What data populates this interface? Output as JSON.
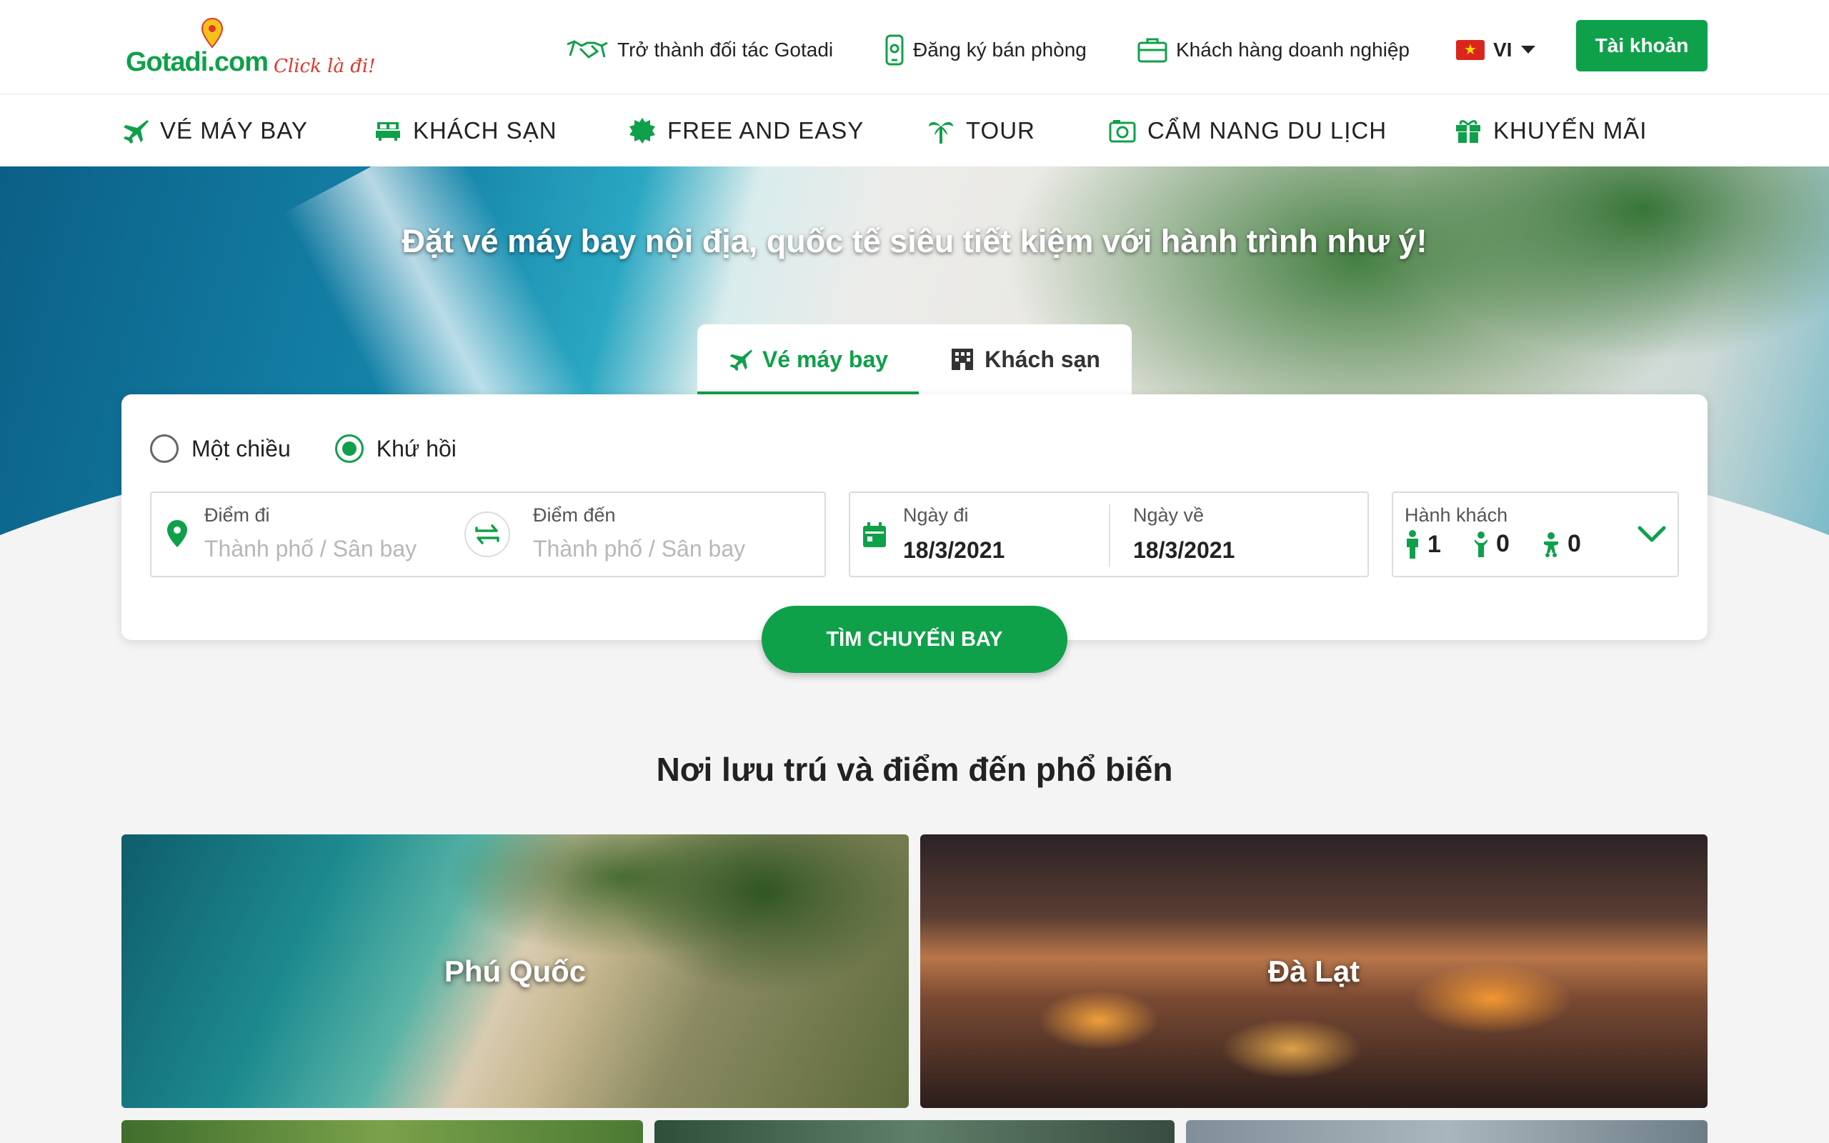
{
  "brand": {
    "logo_main": "Gotadi",
    "logo_com": ".com",
    "logo_tagline": "Click là đi!"
  },
  "top_links": [
    {
      "label": "Trở thành đối tác Gotadi",
      "icon": "handshake-icon"
    },
    {
      "label": "Đăng ký bán phòng",
      "icon": "phone-icon"
    },
    {
      "label": "Khách hàng doanh nghiệp",
      "icon": "briefcase-icon"
    }
  ],
  "language": {
    "code": "VI",
    "flag": "vietnam-flag-icon"
  },
  "account_label": "Tài khoản",
  "nav": [
    {
      "label": "VÉ MÁY BAY",
      "icon": "airplane-icon"
    },
    {
      "label": "KHÁCH SẠN",
      "icon": "bed-icon"
    },
    {
      "label": "FREE AND EASY",
      "icon": "badge-icon"
    },
    {
      "label": "TOUR",
      "icon": "palm-tree-icon"
    },
    {
      "label": "CẨM NANG DU LỊCH",
      "icon": "camera-icon"
    },
    {
      "label": "KHUYẾN MÃI",
      "icon": "gift-icon"
    }
  ],
  "hero": {
    "title": "Đặt vé máy bay nội địa, quốc tế siêu tiết kiệm với hành trình như ý!"
  },
  "search": {
    "tabs": [
      {
        "label": "Vé máy bay",
        "active": true
      },
      {
        "label": "Khách sạn",
        "active": false
      }
    ],
    "trip_types": [
      {
        "label": "Một chiều",
        "selected": false
      },
      {
        "label": "Khứ hồi",
        "selected": true
      }
    ],
    "origin": {
      "label": "Điểm đi",
      "placeholder": "Thành phố / Sân bay"
    },
    "destination": {
      "label": "Điểm đến",
      "placeholder": "Thành phố / Sân bay"
    },
    "depart": {
      "label": "Ngày đi",
      "value": "18/3/2021"
    },
    "return": {
      "label": "Ngày về",
      "value": "18/3/2021"
    },
    "passengers": {
      "label": "Hành khách",
      "adults": "1",
      "children": "0",
      "infants": "0"
    },
    "submit_label": "TÌM CHUYẾN BAY"
  },
  "popular": {
    "title": "Nơi lưu trú và điểm đến phổ biến",
    "destinations": [
      {
        "name": "Phú Quốc"
      },
      {
        "name": "Đà Lạt"
      }
    ]
  },
  "colors": {
    "brand_green": "#0fa04a",
    "logo_red": "#e0362c"
  }
}
